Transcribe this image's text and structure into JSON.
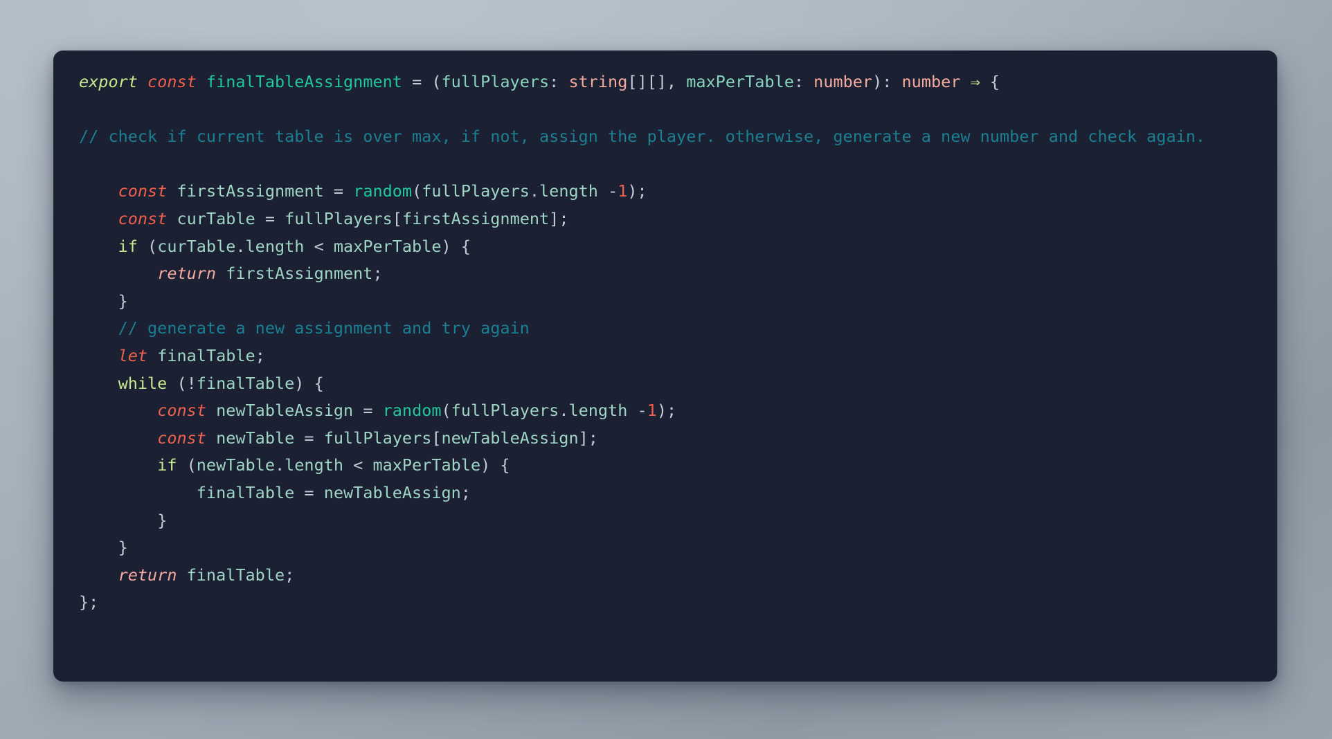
{
  "window": {
    "kind": "code-snippet-card",
    "background_color": "#a5b0ba",
    "card_color": "#1c2033",
    "language": "TypeScript"
  },
  "theme": {
    "name": "dark-material-palenight",
    "background": "#1c2033",
    "default_text": "#c3cbd4",
    "keyword_export": "#c3e88d",
    "keyword_declaration": "#f0604d",
    "keyword_control": "#c3e88d",
    "keyword_return": "#f5a8a0",
    "function_name": "#21c79b",
    "identifier": "#9fd5c4",
    "parameter": "#88d5bd",
    "type": "#f5aa9f",
    "number": "#f0604d",
    "comment": "#1b7f92",
    "punctuation": "#c3cbd4",
    "arrow": "#c3e88d"
  },
  "code": {
    "full_text": "export const finalTableAssignment = (fullPlayers: string[][], maxPerTable: number): number => {\n\n// check if current table is over max, if not, assign the player. otherwise, generate a new number and check again.\n\n    const firstAssignment = random(fullPlayers.length -1);\n    const curTable = fullPlayers[firstAssignment];\n    if (curTable.length < maxPerTable) {\n        return firstAssignment;\n    }\n    // generate a new assignment and try again\n    let finalTable;\n    while (!finalTable) {\n        const newTableAssign = random(fullPlayers.length -1);\n        const newTable = fullPlayers[newTableAssign];\n        if (newTable.length < maxPerTable) {\n            finalTable = newTableAssign;\n        }\n    }\n    return finalTable;\n};",
    "lines": [
      {
        "n": 1,
        "text": "export const finalTableAssignment = (fullPlayers: string[][], maxPerTable: number): number => {",
        "tokens": [
          {
            "t": "export",
            "c": "keyword_export"
          },
          {
            "t": " ",
            "c": "punctuation"
          },
          {
            "t": "const",
            "c": "keyword_declaration"
          },
          {
            "t": " ",
            "c": "punctuation"
          },
          {
            "t": "finalTableAssignment",
            "c": "function_name"
          },
          {
            "t": " = (",
            "c": "punctuation"
          },
          {
            "t": "fullPlayers",
            "c": "parameter"
          },
          {
            "t": ": ",
            "c": "punctuation"
          },
          {
            "t": "string",
            "c": "type"
          },
          {
            "t": "[][], ",
            "c": "punctuation"
          },
          {
            "t": "maxPerTable",
            "c": "parameter"
          },
          {
            "t": ": ",
            "c": "punctuation"
          },
          {
            "t": "number",
            "c": "type"
          },
          {
            "t": "): ",
            "c": "punctuation"
          },
          {
            "t": "number",
            "c": "type"
          },
          {
            "t": " ",
            "c": "punctuation"
          },
          {
            "t": "⇒",
            "c": "arrow"
          },
          {
            "t": " {",
            "c": "punctuation"
          }
        ]
      },
      {
        "n": 2,
        "text": "",
        "tokens": []
      },
      {
        "n": 3,
        "text": "// check if current table is over max, if not, assign the player. otherwise, generate a new number and check again.",
        "tokens": [
          {
            "t": "// check if current table is over max, if not, assign the player. otherwise, generate a new number and check again.",
            "c": "comment"
          }
        ]
      },
      {
        "n": 4,
        "text": "",
        "tokens": []
      },
      {
        "n": 5,
        "text": "    const firstAssignment = random(fullPlayers.length -1);",
        "indent": 4,
        "tokens": [
          {
            "t": "const",
            "c": "keyword_declaration"
          },
          {
            "t": " ",
            "c": "punctuation"
          },
          {
            "t": "firstAssignment",
            "c": "identifier"
          },
          {
            "t": " = ",
            "c": "punctuation"
          },
          {
            "t": "random",
            "c": "function_name"
          },
          {
            "t": "(",
            "c": "punctuation"
          },
          {
            "t": "fullPlayers",
            "c": "identifier"
          },
          {
            "t": ".",
            "c": "punctuation"
          },
          {
            "t": "length",
            "c": "identifier"
          },
          {
            "t": " -",
            "c": "punctuation"
          },
          {
            "t": "1",
            "c": "number"
          },
          {
            "t": ");",
            "c": "punctuation"
          }
        ]
      },
      {
        "n": 6,
        "text": "    const curTable = fullPlayers[firstAssignment];",
        "indent": 4,
        "tokens": [
          {
            "t": "const",
            "c": "keyword_declaration"
          },
          {
            "t": " ",
            "c": "punctuation"
          },
          {
            "t": "curTable",
            "c": "identifier"
          },
          {
            "t": " = ",
            "c": "punctuation"
          },
          {
            "t": "fullPlayers",
            "c": "identifier"
          },
          {
            "t": "[",
            "c": "punctuation"
          },
          {
            "t": "firstAssignment",
            "c": "identifier"
          },
          {
            "t": "];",
            "c": "punctuation"
          }
        ]
      },
      {
        "n": 7,
        "text": "    if (curTable.length < maxPerTable) {",
        "indent": 4,
        "tokens": [
          {
            "t": "if",
            "c": "keyword_control"
          },
          {
            "t": " (",
            "c": "punctuation"
          },
          {
            "t": "curTable",
            "c": "identifier"
          },
          {
            "t": ".",
            "c": "punctuation"
          },
          {
            "t": "length",
            "c": "identifier"
          },
          {
            "t": " < ",
            "c": "punctuation"
          },
          {
            "t": "maxPerTable",
            "c": "identifier"
          },
          {
            "t": ") {",
            "c": "punctuation"
          }
        ]
      },
      {
        "n": 8,
        "text": "        return firstAssignment;",
        "indent": 8,
        "tokens": [
          {
            "t": "return",
            "c": "keyword_return"
          },
          {
            "t": " ",
            "c": "punctuation"
          },
          {
            "t": "firstAssignment",
            "c": "identifier"
          },
          {
            "t": ";",
            "c": "punctuation"
          }
        ]
      },
      {
        "n": 9,
        "text": "    }",
        "indent": 4,
        "tokens": [
          {
            "t": "}",
            "c": "punctuation"
          }
        ]
      },
      {
        "n": 10,
        "text": "    // generate a new assignment and try again",
        "indent": 4,
        "tokens": [
          {
            "t": "// generate a new assignment and try again",
            "c": "comment"
          }
        ]
      },
      {
        "n": 11,
        "text": "    let finalTable;",
        "indent": 4,
        "tokens": [
          {
            "t": "let",
            "c": "keyword_declaration"
          },
          {
            "t": " ",
            "c": "punctuation"
          },
          {
            "t": "finalTable",
            "c": "identifier"
          },
          {
            "t": ";",
            "c": "punctuation"
          }
        ]
      },
      {
        "n": 12,
        "text": "    while (!finalTable) {",
        "indent": 4,
        "tokens": [
          {
            "t": "while",
            "c": "keyword_control"
          },
          {
            "t": " (!",
            "c": "punctuation"
          },
          {
            "t": "finalTable",
            "c": "identifier"
          },
          {
            "t": ") {",
            "c": "punctuation"
          }
        ]
      },
      {
        "n": 13,
        "text": "        const newTableAssign = random(fullPlayers.length -1);",
        "indent": 8,
        "tokens": [
          {
            "t": "const",
            "c": "keyword_declaration"
          },
          {
            "t": " ",
            "c": "punctuation"
          },
          {
            "t": "newTableAssign",
            "c": "identifier"
          },
          {
            "t": " = ",
            "c": "punctuation"
          },
          {
            "t": "random",
            "c": "function_name"
          },
          {
            "t": "(",
            "c": "punctuation"
          },
          {
            "t": "fullPlayers",
            "c": "identifier"
          },
          {
            "t": ".",
            "c": "punctuation"
          },
          {
            "t": "length",
            "c": "identifier"
          },
          {
            "t": " -",
            "c": "punctuation"
          },
          {
            "t": "1",
            "c": "number"
          },
          {
            "t": ");",
            "c": "punctuation"
          }
        ]
      },
      {
        "n": 14,
        "text": "        const newTable = fullPlayers[newTableAssign];",
        "indent": 8,
        "tokens": [
          {
            "t": "const",
            "c": "keyword_declaration"
          },
          {
            "t": " ",
            "c": "punctuation"
          },
          {
            "t": "newTable",
            "c": "identifier"
          },
          {
            "t": " = ",
            "c": "punctuation"
          },
          {
            "t": "fullPlayers",
            "c": "identifier"
          },
          {
            "t": "[",
            "c": "punctuation"
          },
          {
            "t": "newTableAssign",
            "c": "identifier"
          },
          {
            "t": "];",
            "c": "punctuation"
          }
        ]
      },
      {
        "n": 15,
        "text": "        if (newTable.length < maxPerTable) {",
        "indent": 8,
        "tokens": [
          {
            "t": "if",
            "c": "keyword_control"
          },
          {
            "t": " (",
            "c": "punctuation"
          },
          {
            "t": "newTable",
            "c": "identifier"
          },
          {
            "t": ".",
            "c": "punctuation"
          },
          {
            "t": "length",
            "c": "identifier"
          },
          {
            "t": " < ",
            "c": "punctuation"
          },
          {
            "t": "maxPerTable",
            "c": "identifier"
          },
          {
            "t": ") {",
            "c": "punctuation"
          }
        ]
      },
      {
        "n": 16,
        "text": "            finalTable = newTableAssign;",
        "indent": 12,
        "tokens": [
          {
            "t": "finalTable",
            "c": "identifier"
          },
          {
            "t": " = ",
            "c": "punctuation"
          },
          {
            "t": "newTableAssign",
            "c": "identifier"
          },
          {
            "t": ";",
            "c": "punctuation"
          }
        ]
      },
      {
        "n": 17,
        "text": "        }",
        "indent": 8,
        "tokens": [
          {
            "t": "}",
            "c": "punctuation"
          }
        ]
      },
      {
        "n": 18,
        "text": "    }",
        "indent": 4,
        "tokens": [
          {
            "t": "}",
            "c": "punctuation"
          }
        ]
      },
      {
        "n": 19,
        "text": "    return finalTable;",
        "indent": 4,
        "tokens": [
          {
            "t": "return",
            "c": "keyword_return"
          },
          {
            "t": " ",
            "c": "punctuation"
          },
          {
            "t": "finalTable",
            "c": "identifier"
          },
          {
            "t": ";",
            "c": "punctuation"
          }
        ]
      },
      {
        "n": 20,
        "text": "};",
        "indent": 0,
        "tokens": [
          {
            "t": "};",
            "c": "punctuation"
          }
        ]
      }
    ]
  }
}
